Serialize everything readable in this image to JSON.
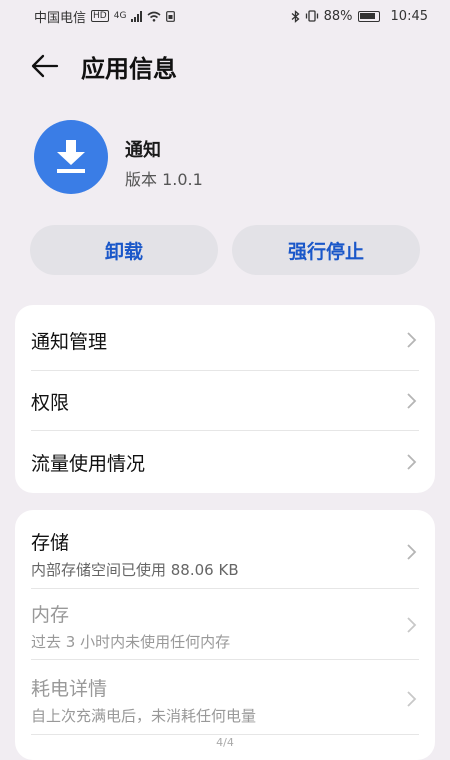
{
  "status_bar": {
    "carrier": "中国电信",
    "badge": "HD",
    "network": "4G",
    "battery_percent": "88%",
    "time": "10:45"
  },
  "header": {
    "title": "应用信息"
  },
  "app": {
    "name": "通知",
    "version": "版本 1.0.1",
    "icon": "download-icon",
    "icon_color": "#3a7de6"
  },
  "actions": {
    "uninstall": "卸载",
    "force_stop": "强行停止"
  },
  "card1": {
    "items": [
      {
        "label": "通知管理"
      },
      {
        "label": "权限"
      },
      {
        "label": "流量使用情况"
      }
    ]
  },
  "card2": {
    "items": [
      {
        "label": "存储",
        "sub": "内部存储空间已使用 88.06 KB"
      },
      {
        "label": "内存",
        "sub": "过去 3 小时内未使用任何内存"
      },
      {
        "label": "耗电详情",
        "sub": "自上次充满电后，未消耗任何电量"
      }
    ]
  },
  "pager": "4/4",
  "colors": {
    "accent": "#1a57c9",
    "background": "#f1edf2"
  }
}
